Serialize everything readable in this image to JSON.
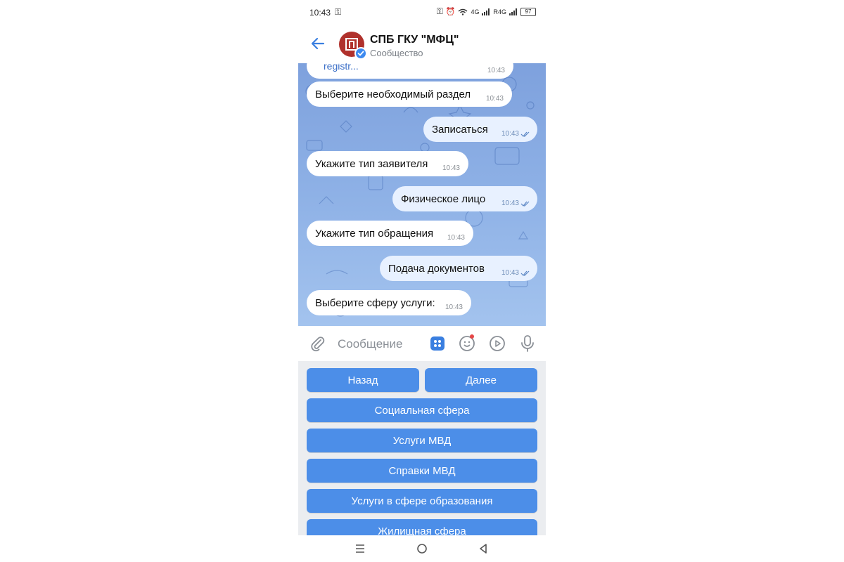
{
  "status_bar": {
    "time": "10:43",
    "network_1": "4G",
    "network_2": "R4G",
    "battery": "97"
  },
  "header": {
    "title": "СПБ ГКУ \"МФЦ\"",
    "subtitle": "Сообщество"
  },
  "chat": {
    "partial_link": "registr...",
    "partial_time": "10:43",
    "messages": [
      {
        "direction": "in",
        "text": "Выберите необходимый раздел",
        "time": "10:43"
      },
      {
        "direction": "out",
        "text": "Записаться",
        "time": "10:43"
      },
      {
        "direction": "in",
        "text": "Укажите тип заявителя",
        "time": "10:43"
      },
      {
        "direction": "out",
        "text": "Физическое лицо",
        "time": "10:43"
      },
      {
        "direction": "in",
        "text": "Укажите тип обращения",
        "time": "10:43"
      },
      {
        "direction": "out",
        "text": "Подача документов",
        "time": "10:43"
      },
      {
        "direction": "in",
        "text": "Выберите сферу услуги:",
        "time": "10:43"
      }
    ]
  },
  "composer": {
    "placeholder": "Сообщение"
  },
  "keyboard": {
    "buttons": [
      {
        "label": "Назад"
      },
      {
        "label": "Далее"
      },
      {
        "label": "Социальная сфера"
      },
      {
        "label": "Услуги МВД"
      },
      {
        "label": "Справки МВД"
      },
      {
        "label": "Услуги в сфере образования"
      },
      {
        "label": "Жилищная сфера"
      }
    ]
  },
  "colors": {
    "accent": "#4c8ee8",
    "chat_bg": "#8eb1e6",
    "avatar": "#b0312c"
  }
}
